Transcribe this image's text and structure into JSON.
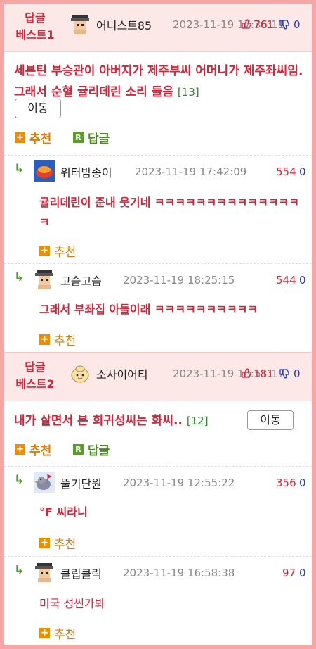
{
  "best1": {
    "label_line1": "답글",
    "label_line2": "베스트1",
    "author": "어니스트85",
    "date": "2023-11-19 17:36:11",
    "upvotes": "761",
    "downvotes": "0",
    "title": "세븐틴 부승관이 아버지가 제주부씨 어머니가 제주좌씨임. 그래서 순혈 귤리데린 소리 들음",
    "comment_count": "[13]",
    "move_label": "이동",
    "recommend_label": "추천",
    "reply_label": "답글",
    "comments": [
      {
        "author": "워터밤송이",
        "date": "2023-11-19 17:42:09",
        "upvotes": "554",
        "downvotes": "0",
        "text": "귤리데린이 준내 웃기네 ㅋㅋㅋㅋㅋㅋㅋㅋㅋㅋㅋㅋㅋㅋㅋ",
        "recommend_label": "추천"
      },
      {
        "author": "고슴고슴",
        "date": "2023-11-19 18:25:15",
        "upvotes": "544",
        "downvotes": "0",
        "text": "그래서 부좌집 아들이래 ㅋㅋㅋㅋㅋㅋㅋㅋㅋㅋ",
        "recommend_label": "추천"
      }
    ]
  },
  "best2": {
    "label_line1": "답글",
    "label_line2": "베스트2",
    "author": "소사이어티",
    "date": "2023-11-19 15:51:17",
    "upvotes": "181",
    "downvotes": "0",
    "title": "내가 살면서 본 희귀성씨는 화씨..",
    "comment_count": "[12]",
    "move_label": "이동",
    "recommend_label": "추천",
    "reply_label": "답글",
    "comments": [
      {
        "author": "뚤기단원",
        "date": "2023-11-19 12:55:22",
        "upvotes": "356",
        "downvotes": "0",
        "text": "°F 씨라니",
        "recommend_label": "추천"
      },
      {
        "author": "클립클릭",
        "date": "2023-11-19 16:58:38",
        "upvotes": "97",
        "downvotes": "0",
        "text": "미국 성씬가봐",
        "recommend_label": "추천"
      }
    ]
  },
  "colors": {
    "accent_red": "#d6243a",
    "recommend_orange": "#e07a00",
    "reply_green": "#4a8b1e",
    "frame_pink": "#f7a6a6",
    "header_bg": "#fde8e8"
  }
}
